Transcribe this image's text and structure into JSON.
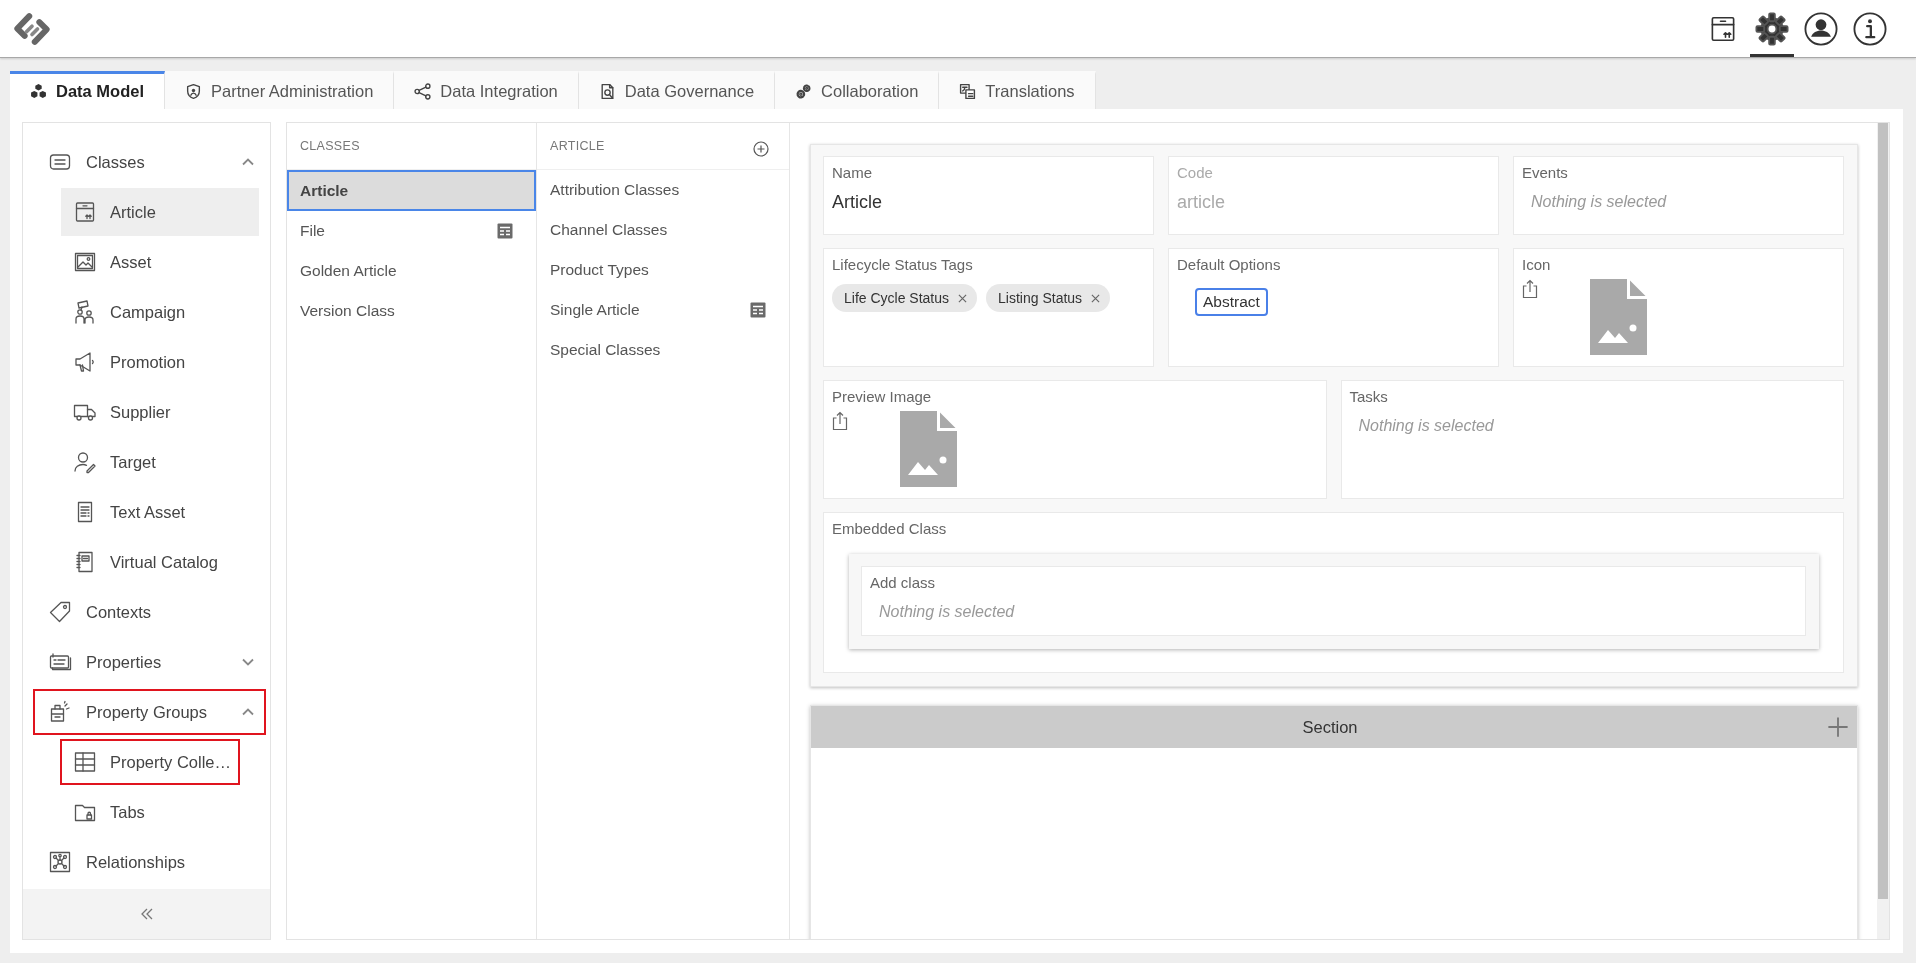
{
  "top_bar": {
    "actions": [
      {
        "kind": "box",
        "selected": false
      },
      {
        "kind": "settings",
        "selected": true
      },
      {
        "kind": "user",
        "selected": false
      },
      {
        "kind": "info",
        "selected": false
      }
    ]
  },
  "tabs": [
    {
      "label": "Data Model",
      "kind": "data-model",
      "selected": true
    },
    {
      "label": "Partner Administration",
      "kind": "partner",
      "selected": false
    },
    {
      "label": "Data Integration",
      "kind": "integration",
      "selected": false
    },
    {
      "label": "Data Governance",
      "kind": "governance",
      "selected": false
    },
    {
      "label": "Collaboration",
      "kind": "collaboration",
      "selected": false
    },
    {
      "label": "Translations",
      "kind": "translations",
      "selected": false
    }
  ],
  "sidebar": {
    "items": [
      {
        "label": "Classes",
        "kind": "classes",
        "expanded": true,
        "selected": false,
        "highlighted": false,
        "children": [
          {
            "label": "Article",
            "kind": "article",
            "selected": true,
            "highlighted": false
          },
          {
            "label": "Asset",
            "kind": "asset",
            "selected": false,
            "highlighted": false
          },
          {
            "label": "Campaign",
            "kind": "campaign",
            "selected": false,
            "highlighted": false
          },
          {
            "label": "Promotion",
            "kind": "promotion",
            "selected": false,
            "highlighted": false
          },
          {
            "label": "Supplier",
            "kind": "supplier",
            "selected": false,
            "highlighted": false
          },
          {
            "label": "Target",
            "kind": "target",
            "selected": false,
            "highlighted": false
          },
          {
            "label": "Text Asset",
            "kind": "text-asset",
            "selected": false,
            "highlighted": false
          },
          {
            "label": "Virtual Catalog",
            "kind": "virtual-catalog",
            "selected": false,
            "highlighted": false
          }
        ]
      },
      {
        "label": "Contexts",
        "kind": "contexts",
        "selected": false,
        "highlighted": false
      },
      {
        "label": "Properties",
        "kind": "properties",
        "expanded": false,
        "selected": false,
        "highlighted": false
      },
      {
        "label": "Property Groups",
        "kind": "property-groups",
        "expanded": true,
        "selected": false,
        "highlighted": true,
        "children": [
          {
            "label": "Property Colle…",
            "kind": "property-collection",
            "selected": false,
            "highlighted": true
          },
          {
            "label": "Tabs",
            "kind": "tabs",
            "selected": false,
            "highlighted": false
          }
        ]
      },
      {
        "label": "Relationships",
        "kind": "relationships",
        "selected": false,
        "highlighted": false
      }
    ]
  },
  "classes_list": {
    "title": "CLASSES",
    "items": [
      {
        "label": "Article",
        "selected": true,
        "card_icon": false
      },
      {
        "label": "File",
        "selected": false,
        "card_icon": true
      },
      {
        "label": "Golden Article",
        "selected": false,
        "card_icon": false
      },
      {
        "label": "Version Class",
        "selected": false,
        "card_icon": false
      }
    ]
  },
  "article_list": {
    "title": "ARTICLE",
    "items": [
      {
        "label": "Attribution Classes",
        "selected": false,
        "card_icon": false
      },
      {
        "label": "Channel Classes",
        "selected": false,
        "card_icon": false
      },
      {
        "label": "Product Types",
        "selected": false,
        "card_icon": false
      },
      {
        "label": "Single Article",
        "selected": false,
        "card_icon": true
      },
      {
        "label": "Special Classes",
        "selected": false,
        "card_icon": false
      }
    ]
  },
  "form": {
    "rows": [
      {
        "fields": [
          {
            "kind": "text",
            "label": "Name",
            "value": "Article",
            "disabled": false
          },
          {
            "kind": "text",
            "label": "Code",
            "value": "article",
            "disabled": true
          },
          {
            "kind": "select",
            "label": "Events",
            "placeholder": "Nothing is selected"
          }
        ]
      },
      {
        "fields": [
          {
            "kind": "tags",
            "label": "Lifecycle Status Tags",
            "tags": [
              {
                "label": "Life Cycle Status"
              },
              {
                "label": "Listing Status"
              }
            ]
          },
          {
            "kind": "options",
            "label": "Default Options",
            "options": [
              {
                "label": "Abstract",
                "selected": true
              }
            ]
          },
          {
            "kind": "image",
            "label": "Icon"
          }
        ]
      },
      {
        "fields": [
          {
            "kind": "image",
            "label": "Preview Image"
          },
          {
            "kind": "select",
            "label": "Tasks",
            "placeholder": "Nothing is selected"
          }
        ]
      },
      {
        "fields": [
          {
            "kind": "embedded",
            "label": "Embedded Class",
            "inner": {
              "label": "Add class",
              "placeholder": "Nothing is selected"
            }
          }
        ]
      }
    ]
  },
  "section": {
    "title": "Section"
  }
}
